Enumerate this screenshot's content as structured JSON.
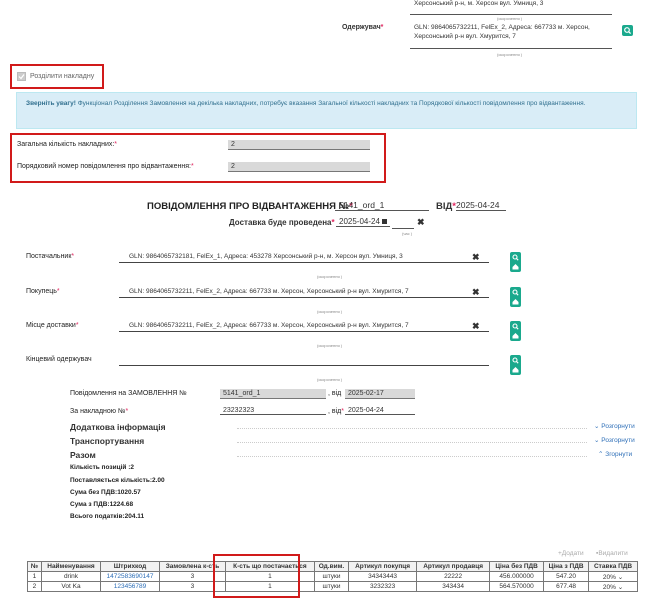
{
  "top": {
    "supplier_addr": "Херсонський р-н, м. Херсон вул. Умниця, 3",
    "receiver_label": "Одержувач",
    "receiver_value": "GLN: 9864065732211, FelEx_2, Адреса: 667733 м. Херсон, Херсонський р-н вул. Хмуритcя, 7",
    "small_caption": "(скорочення )"
  },
  "split": {
    "label": "Розділити накладну"
  },
  "alert": {
    "bold": "Зверніть увагу!",
    "text": "Функціонал Розділення Замовлення на декілька накладних, потребує вказання Загальної кількості накладних та Порядкової кількості повідомлення про відвантаження."
  },
  "counts": {
    "total_label": "Загальна кількість накладних:",
    "total_value": "2",
    "seq_label": "Порядковий номер повідомлення про відвантаження:",
    "seq_value": "2"
  },
  "header": {
    "title": "ПОВІДОМЛЕННЯ ПРО ВІДВАНТАЖЕННЯ №",
    "number": "5141_ord_1",
    "from_label": "ВІД",
    "from_date": "2025-04-24",
    "delivery_label": "Доставка буде проведена",
    "delivery_date": "2025-04-24",
    "delivery_caption": "(час )"
  },
  "parties": [
    {
      "label": "Постачальник",
      "required": true,
      "value": "GLN: 9864065732181, FelEx_1, Адреса: 453278 Херсонський р-н, м. Херсон вул. Умниця, 3"
    },
    {
      "label": "Покупець",
      "required": true,
      "value": "GLN: 9864065732211, FelEx_2, Адреса: 667733 м. Херсон, Херсонський р-н вул. Хмуритcя, 7"
    },
    {
      "label": "Місце доставки",
      "required": true,
      "value": "GLN: 9864065732211, FelEx_2, Адреса: 667733 м. Херсон, Херсонський р-н вул. Хмуритcя, 7"
    },
    {
      "label": "Кінцевий одержувач",
      "required": false,
      "value": ""
    }
  ],
  "order": {
    "label": "Повідомлення на ЗАМОВЛЕННЯ №",
    "value": "5141_ord_1",
    "from_label": ", від",
    "from_date": "2025-02-17",
    "invoice_label": "За накладною №",
    "invoice_value": "23232323",
    "invoice_from": "2025-04-24"
  },
  "sections": {
    "additional": "Додаткова інформація",
    "transport": "Транспортування",
    "total": "Разом",
    "expand": "Розгорнути",
    "collapse": "Згорнути"
  },
  "summary": {
    "positions": "Кількість позицій :2",
    "delivered": "Поставляється кількість:2.00",
    "no_vat": "Сума без ПДВ:1020.57",
    "with_vat": "Сума з ПДВ:1224.68",
    "taxes": "Всього податків:204.11"
  },
  "table_actions": {
    "add": "Додати",
    "delete": "Видалити"
  },
  "table": {
    "headers": [
      "№",
      "Найменування",
      "Штрихкод",
      "Замовлена к-сть",
      "К-сть що постачається",
      "Од.вим.",
      "Артикул покупця",
      "Артикул продавця",
      "Ціна без ПДВ",
      "Ціна з ПДВ",
      "Ставка ПДВ"
    ],
    "rows": [
      [
        "1",
        "drink",
        "1472583690147",
        "3",
        "1",
        "штуки",
        "34343443",
        "22222",
        "456.000000",
        "547.20",
        "20%"
      ],
      [
        "2",
        "Vot Ka",
        "123456789",
        "3",
        "1",
        "штуки",
        "3232323",
        "343434",
        "564.570000",
        "677.48",
        "20%"
      ]
    ]
  },
  "colors": {
    "accent_green": "#1aa98d",
    "alert_bg": "#d9edf7",
    "highlight_red": "#d11a1a",
    "link_blue": "#2e6fb8"
  }
}
